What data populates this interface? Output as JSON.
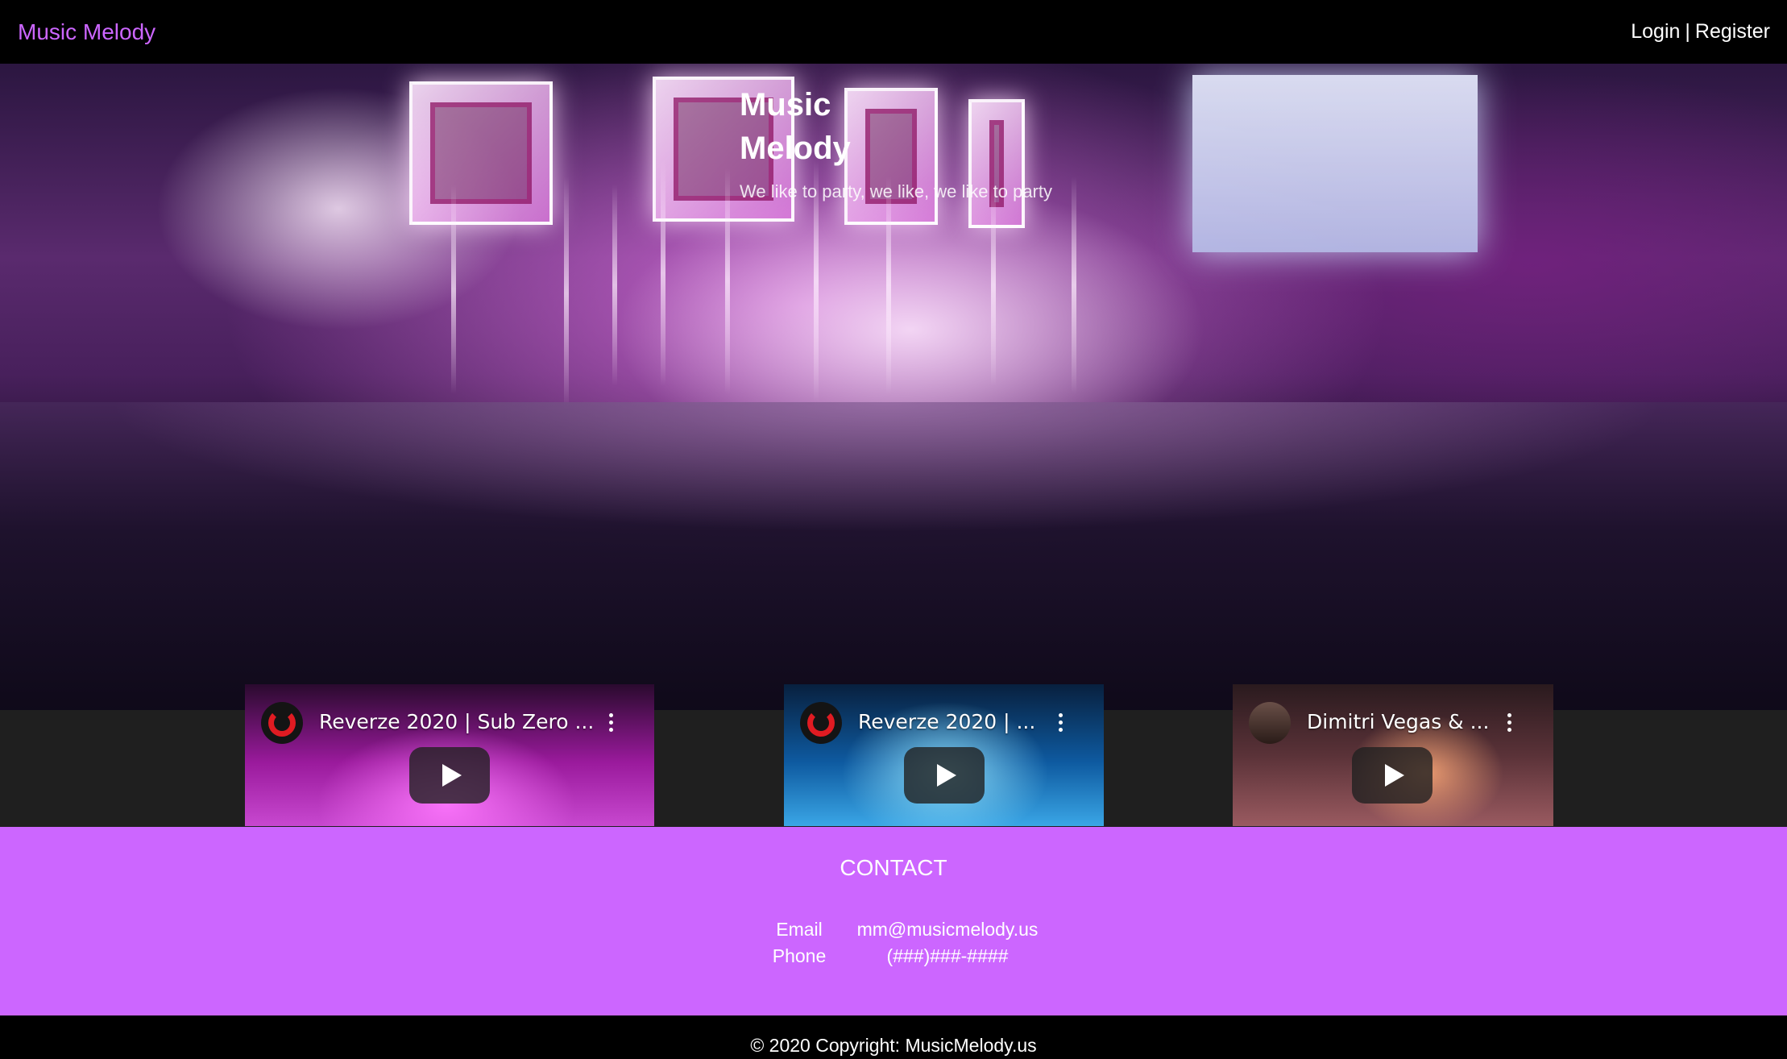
{
  "nav": {
    "brand": "Music Melody",
    "login": "Login",
    "separator": "|",
    "register": "Register"
  },
  "hero": {
    "title": "Music Melody",
    "subtitle": "We like to party, we like, we like to party"
  },
  "videos": [
    {
      "title": "Reverze 2020 | Sub Zero ...",
      "channel_icon": "red-channel-logo-icon"
    },
    {
      "title": "Reverze 2020 | ...",
      "channel_icon": "red-channel-logo-icon"
    },
    {
      "title": "Dimitri Vegas & ...",
      "channel_icon": "artist-avatar-icon"
    }
  ],
  "contact": {
    "heading": "CONTACT",
    "email_label": "Email",
    "email_value": "mm@musicmelody.us",
    "phone_label": "Phone",
    "phone_value": "(###)###-####"
  },
  "footer": {
    "copyright": "© 2020 Copyright: MusicMelody.us"
  },
  "colors": {
    "accent": "#cc66ff",
    "topbar": "#000000",
    "video_strip": "#1f1f1f"
  }
}
